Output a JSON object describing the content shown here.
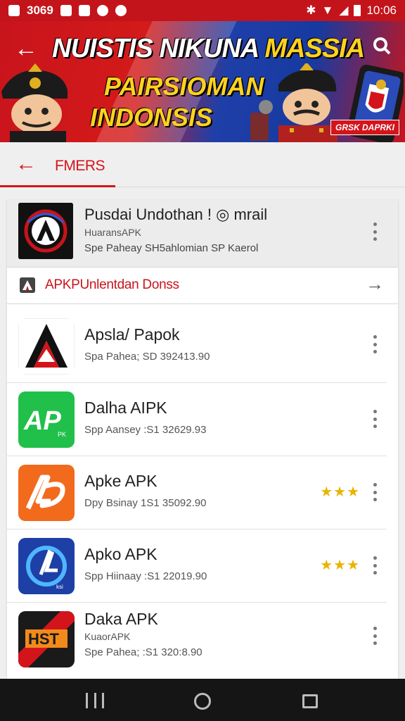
{
  "status_bar": {
    "left_text": "3069",
    "time": "10:06",
    "icons": [
      "notification-icon",
      "message-icon",
      "vpn-icon",
      "sync-icon",
      "bluetooth-icon",
      "signal-icon",
      "wifi-icon",
      "battery-icon"
    ]
  },
  "banner": {
    "title_line1_a": "NUISTIS NIKUNA",
    "title_line1_b": "MASSIA",
    "title_line2": "PAIRSIOMAN",
    "title_line3": "INDONSIS",
    "badge": "GRSK DAPRKI",
    "colors": {
      "red": "#c8141c",
      "blue": "#1f3fa8",
      "yellow": "#ffd21f"
    }
  },
  "tabbar": {
    "label": "FMERS",
    "accent": "#d4141b"
  },
  "featured": {
    "title": "Pusdai Undothan ! ◎ mrail",
    "subtitle": "HuaransAPK",
    "meta": "Spe Paheay SH5ahlomian SP Kaerol"
  },
  "promo": {
    "text": "APKPUnlentdan Donss"
  },
  "apps": [
    {
      "name": "Apsla/ Papok",
      "sub": "",
      "meta": "Spa Pahea; SD 392413.90",
      "rating": 0
    },
    {
      "name": "Dalha AIPK",
      "sub": "",
      "meta": "Spp Aansey :S1 32629.93",
      "rating": 0
    },
    {
      "name": "Apke APK",
      "sub": "",
      "meta": "Dpy Bsinay 1S1 35092.90",
      "rating": 3
    },
    {
      "name": "Apko APK",
      "sub": "",
      "meta": "Spp Hiinaay :S1 22019.90",
      "rating": 3
    },
    {
      "name": "Daka APK",
      "sub": "KuaorAPK",
      "meta": "Spe Pahea; :S1 320:8.90",
      "rating": 0
    }
  ],
  "icon_text": {
    "app5": "HST"
  }
}
